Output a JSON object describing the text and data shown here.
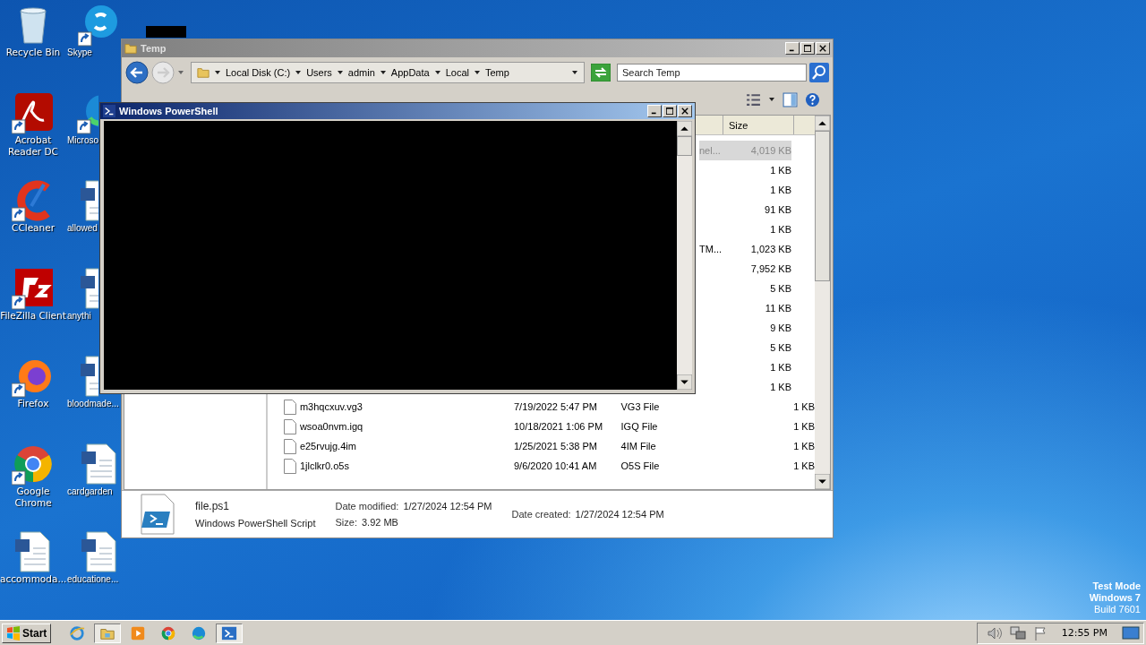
{
  "desktop": {
    "icons": [
      {
        "label": "Recycle Bin",
        "kind": "recycle",
        "shortcut": false
      },
      {
        "label": "Skype",
        "kind": "skype",
        "shortcut": true
      },
      {
        "label": "Acrobat Reader DC",
        "kind": "pdf",
        "shortcut": true
      },
      {
        "label": "Microso",
        "kind": "edge",
        "shortcut": true
      },
      {
        "label": "CCleaner",
        "kind": "ccleaner",
        "shortcut": true
      },
      {
        "label": "allowed",
        "kind": "word",
        "shortcut": false
      },
      {
        "label": "FileZilla Client",
        "kind": "filezilla",
        "shortcut": true
      },
      {
        "label": "anythi",
        "kind": "word",
        "shortcut": false
      },
      {
        "label": "Firefox",
        "kind": "firefox",
        "shortcut": true
      },
      {
        "label": "bloodmade...",
        "kind": "word",
        "shortcut": false
      },
      {
        "label": "Google Chrome",
        "kind": "chrome",
        "shortcut": true
      },
      {
        "label": "cardgarden",
        "kind": "word",
        "shortcut": false
      },
      {
        "label": "accommoda...",
        "kind": "word",
        "shortcut": false
      },
      {
        "label": "educatione...",
        "kind": "word",
        "shortcut": false
      }
    ],
    "watermark_lines": [
      "Test Mode",
      "Windows 7",
      "Build 7601"
    ]
  },
  "explorer": {
    "title": "Temp",
    "breadcrumb": [
      "Local Disk (C:)",
      "Users",
      "admin",
      "AppData",
      "Local",
      "Temp"
    ],
    "search": {
      "placeholder": "Search Temp"
    },
    "columns": [
      "Size"
    ],
    "rows": [
      {
        "name": "",
        "date": "",
        "type": "",
        "fragment": "nel...",
        "size": "4,019 KB",
        "selected": true
      },
      {
        "name": "",
        "date": "",
        "type": "",
        "fragment": "",
        "size": "1 KB",
        "selected": false
      },
      {
        "name": "",
        "date": "",
        "type": "",
        "fragment": "",
        "size": "1 KB",
        "selected": false
      },
      {
        "name": "",
        "date": "",
        "type": "",
        "fragment": "",
        "size": "91 KB",
        "selected": false
      },
      {
        "name": "",
        "date": "",
        "type": "",
        "fragment": "",
        "size": "1 KB",
        "selected": false
      },
      {
        "name": "",
        "date": "",
        "type": "",
        "fragment": "TM...",
        "size": "1,023 KB",
        "selected": false
      },
      {
        "name": "",
        "date": "",
        "type": "",
        "fragment": "",
        "size": "7,952 KB",
        "selected": false
      },
      {
        "name": "",
        "date": "",
        "type": "",
        "fragment": "",
        "size": "5 KB",
        "selected": false
      },
      {
        "name": "",
        "date": "",
        "type": "",
        "fragment": "",
        "size": "11 KB",
        "selected": false
      },
      {
        "name": "",
        "date": "",
        "type": "",
        "fragment": "",
        "size": "9 KB",
        "selected": false
      },
      {
        "name": "",
        "date": "",
        "type": "",
        "fragment": "",
        "size": "5 KB",
        "selected": false
      },
      {
        "name": "",
        "date": "",
        "type": "",
        "fragment": "",
        "size": "1 KB",
        "selected": false
      },
      {
        "name": "",
        "date": "",
        "type": "",
        "fragment": "",
        "size": "1 KB",
        "selected": false
      },
      {
        "name": "m3hqcxuv.vg3",
        "date": "7/19/2022 5:47 PM",
        "type": "VG3 File",
        "fragment": "",
        "size": "1 KB",
        "selected": false
      },
      {
        "name": "wsoa0nvm.igq",
        "date": "10/18/2021 1:06 PM",
        "type": "IGQ File",
        "fragment": "",
        "size": "1 KB",
        "selected": false
      },
      {
        "name": "e25rvujg.4im",
        "date": "1/25/2021 5:38 PM",
        "type": "4IM File",
        "fragment": "",
        "size": "1 KB",
        "selected": false
      },
      {
        "name": "1jlclkr0.o5s",
        "date": "9/6/2020 10:41 AM",
        "type": "O5S File",
        "fragment": "",
        "size": "1 KB",
        "selected": false
      }
    ],
    "details": {
      "name": "file.ps1",
      "type": "Windows PowerShell Script",
      "fields": [
        {
          "label": "Date modified:",
          "value": "1/27/2024 12:54 PM"
        },
        {
          "label": "Size:",
          "value": "3.92 MB"
        },
        {
          "label": "Date created:",
          "value": "1/27/2024 12:54 PM"
        }
      ]
    }
  },
  "powershell": {
    "title": "Windows PowerShell"
  },
  "taskbar": {
    "start": "Start",
    "apps": [
      {
        "kind": "ie",
        "selected": false
      },
      {
        "kind": "folder",
        "selected": true
      },
      {
        "kind": "media",
        "selected": false
      },
      {
        "kind": "chrome",
        "selected": false
      },
      {
        "kind": "edge",
        "selected": false
      },
      {
        "kind": "powershell",
        "selected": true
      }
    ],
    "clock": "12:55 PM"
  }
}
